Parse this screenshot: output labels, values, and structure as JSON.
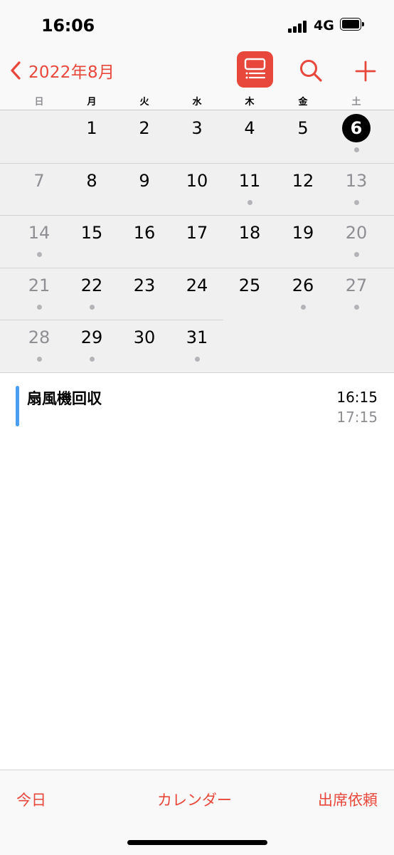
{
  "status_bar": {
    "time": "16:06",
    "network": "4G"
  },
  "nav": {
    "back_label": "2022年8月",
    "accent_color": "#e8473b"
  },
  "weekdays": [
    "日",
    "月",
    "火",
    "水",
    "木",
    "金",
    "土"
  ],
  "calendar": {
    "weeks": [
      [
        {
          "day": "",
          "dot": false
        },
        {
          "day": "1",
          "dot": false
        },
        {
          "day": "2",
          "dot": false
        },
        {
          "day": "3",
          "dot": false
        },
        {
          "day": "4",
          "dot": false
        },
        {
          "day": "5",
          "dot": false
        },
        {
          "day": "6",
          "dot": true,
          "today": true
        }
      ],
      [
        {
          "day": "7",
          "dot": false
        },
        {
          "day": "8",
          "dot": false
        },
        {
          "day": "9",
          "dot": false
        },
        {
          "day": "10",
          "dot": false
        },
        {
          "day": "11",
          "dot": true
        },
        {
          "day": "12",
          "dot": false
        },
        {
          "day": "13",
          "dot": true
        }
      ],
      [
        {
          "day": "14",
          "dot": true
        },
        {
          "day": "15",
          "dot": false
        },
        {
          "day": "16",
          "dot": false
        },
        {
          "day": "17",
          "dot": false
        },
        {
          "day": "18",
          "dot": false
        },
        {
          "day": "19",
          "dot": false
        },
        {
          "day": "20",
          "dot": true
        }
      ],
      [
        {
          "day": "21",
          "dot": true
        },
        {
          "day": "22",
          "dot": true
        },
        {
          "day": "23",
          "dot": false
        },
        {
          "day": "24",
          "dot": false
        },
        {
          "day": "25",
          "dot": false
        },
        {
          "day": "26",
          "dot": true
        },
        {
          "day": "27",
          "dot": true
        }
      ],
      [
        {
          "day": "28",
          "dot": true
        },
        {
          "day": "29",
          "dot": true
        },
        {
          "day": "30",
          "dot": false
        },
        {
          "day": "31",
          "dot": true
        },
        null,
        null,
        null
      ]
    ]
  },
  "event": {
    "title": "扇風機回収",
    "start": "16:15",
    "end": "17:15",
    "color": "#4a9ff0"
  },
  "tabbar": {
    "today": "今日",
    "calendar": "カレンダー",
    "request": "出席依頼"
  },
  "icons": {
    "back": "chevron-left-icon",
    "list_toggle": "list-view-icon",
    "search": "search-icon",
    "add": "plus-icon"
  }
}
